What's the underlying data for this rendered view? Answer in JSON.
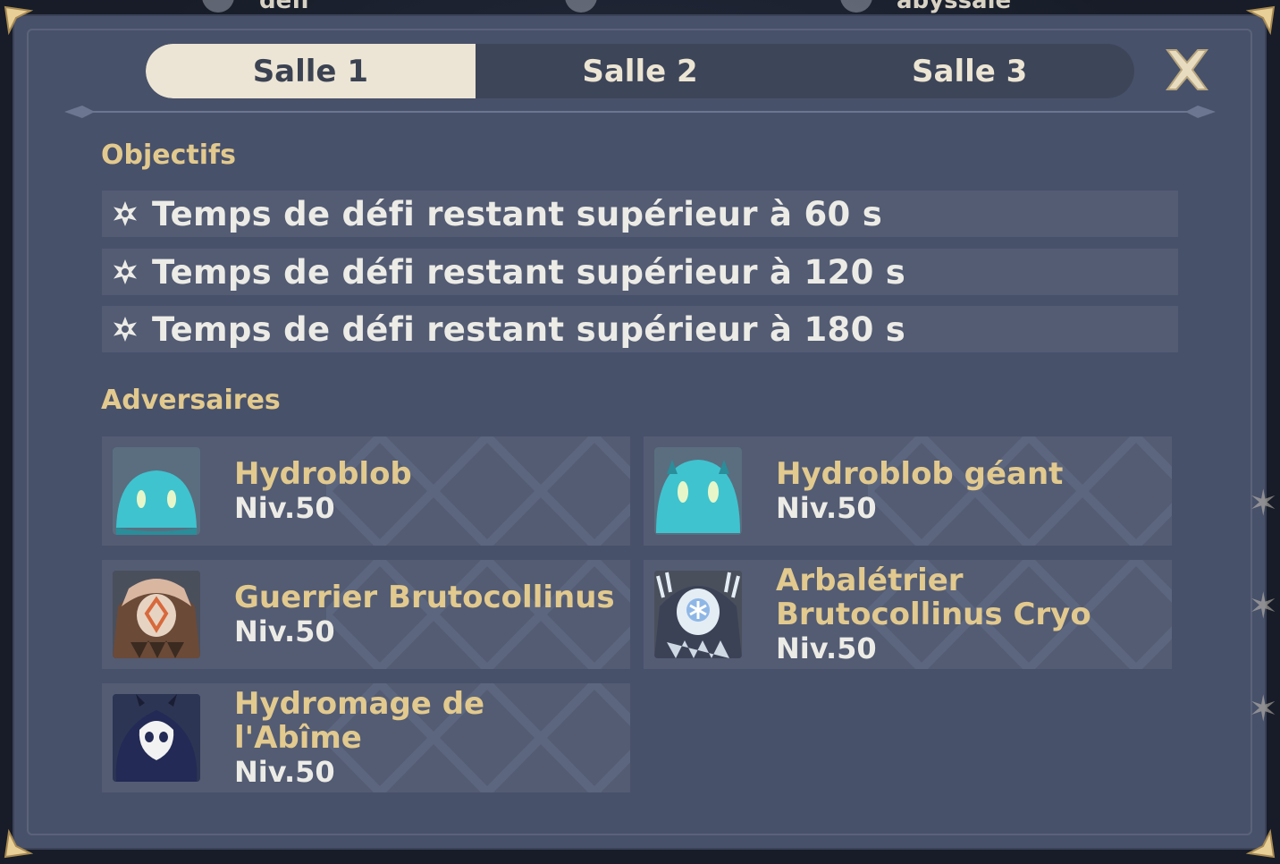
{
  "background": {
    "top_labels": [
      "défi",
      "abyssale"
    ]
  },
  "tabs": [
    {
      "label": "Salle 1",
      "active": true
    },
    {
      "label": "Salle 2",
      "active": false
    },
    {
      "label": "Salle 3",
      "active": false
    }
  ],
  "close_icon": "close-icon",
  "objectives": {
    "title": "Objectifs",
    "items": [
      {
        "icon": "star-icon",
        "text": "Temps de défi restant supérieur à 60 s"
      },
      {
        "icon": "star-icon",
        "text": "Temps de défi restant supérieur à 120 s"
      },
      {
        "icon": "star-icon",
        "text": "Temps de défi restant supérieur à 180 s"
      }
    ]
  },
  "adversaries": {
    "title": "Adversaires",
    "items": [
      {
        "name": "Hydroblob",
        "level": "Niv.50",
        "icon": "hydro-slime-icon"
      },
      {
        "name": "Hydroblob géant",
        "level": "Niv.50",
        "icon": "large-hydro-slime-icon"
      },
      {
        "name": "Guerrier Brutocollinus",
        "level": "Niv.50",
        "icon": "hilichurl-warrior-icon"
      },
      {
        "name": "Arbalétrier Brutocollinus Cryo",
        "level": "Niv.50",
        "icon": "cryo-hilichurl-shooter-icon"
      },
      {
        "name": "Hydromage de l'Abîme",
        "level": "Niv.50",
        "icon": "hydro-abyss-mage-icon"
      }
    ]
  },
  "colors": {
    "panel": "#48516a",
    "row": "#535c73",
    "accent_gold": "#e2c98e",
    "text_light": "#ecebe6",
    "tab_active": "#ece5d5"
  }
}
